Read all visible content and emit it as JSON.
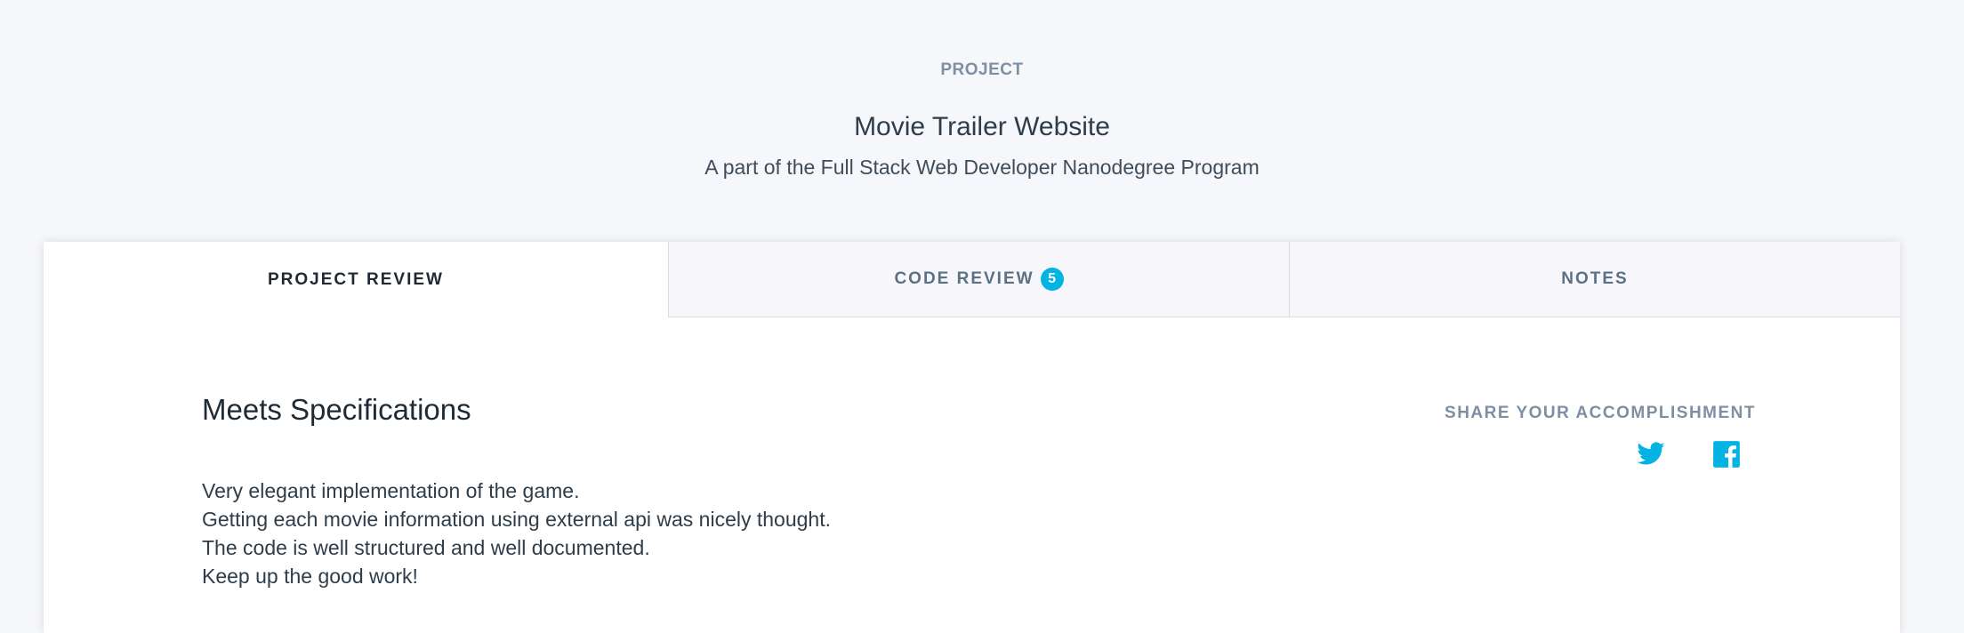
{
  "header": {
    "eyebrow": "PROJECT",
    "title": "Movie Trailer Website",
    "subtitle": "A part of the Full Stack Web Developer Nanodegree Program"
  },
  "tabs": [
    {
      "label": "PROJECT REVIEW",
      "active": true
    },
    {
      "label": "CODE REVIEW",
      "badge": "5",
      "active": false
    },
    {
      "label": "NOTES",
      "active": false
    }
  ],
  "review": {
    "result": "Meets Specifications",
    "lines": [
      "Very elegant implementation of the game.",
      "Getting each movie information using external api was nicely thought.",
      "The code is well structured and well documented.",
      "Keep up the good work!"
    ]
  },
  "share": {
    "label": "SHARE YOUR ACCOMPLISHMENT",
    "icons": [
      "twitter-icon",
      "facebook-icon"
    ]
  },
  "colors": {
    "accent": "#02b3e4",
    "background": "#f6f7fa",
    "muted": "#7d8fa3",
    "text": "#2e3d49"
  }
}
